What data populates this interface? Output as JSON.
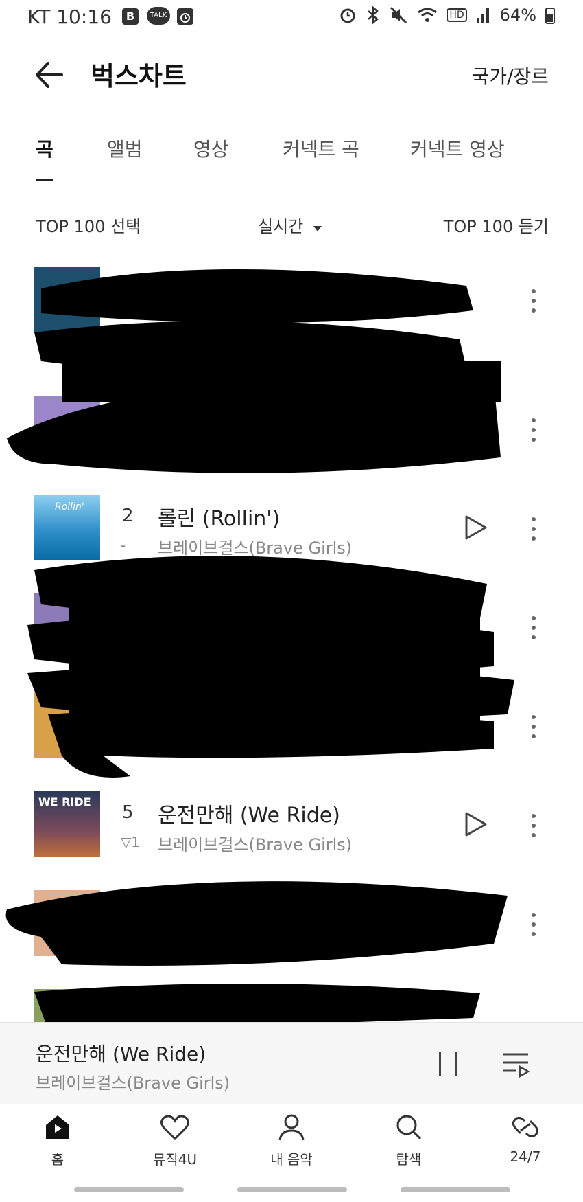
{
  "status_bar": {
    "carrier_time": "KT 10:16",
    "icons": [
      "b-icon",
      "talk-icon",
      "clock-icon",
      "alarm-icon",
      "bluetooth-icon",
      "mute-icon",
      "wifi-icon",
      "hd-icon",
      "signal-icon"
    ],
    "talk_label": "TALK",
    "b_label": "B",
    "hd_label": "HD",
    "battery": "64%"
  },
  "header": {
    "title": "벅스차트",
    "country_genre": "국가/장르"
  },
  "tabs": [
    {
      "label": "곡",
      "active": true
    },
    {
      "label": "앨범"
    },
    {
      "label": "영상"
    },
    {
      "label": "커넥트 곡"
    },
    {
      "label": "커넥트 영상"
    }
  ],
  "controls": {
    "top100_select": "TOP 100 선택",
    "realtime": "실시간",
    "top100_listen": "TOP 100 듣기"
  },
  "songs": [
    {
      "rank": "2",
      "change": "-",
      "title": "롤린 (Rollin')",
      "artist": "브레이브걸스(Brave Girls)",
      "cover_text": "Rollin'"
    },
    {
      "rank": "5",
      "change": "▽1",
      "title": "운전만해 (We Ride)",
      "artist": "브레이브걸스(Brave Girls)",
      "cover_text": "WE RIDE"
    }
  ],
  "mini_player": {
    "title": "운전만해 (We Ride)",
    "artist": "브레이브걸스(Brave Girls)"
  },
  "nav": [
    {
      "label": "홈",
      "icon": "home-icon"
    },
    {
      "label": "뮤직4U",
      "icon": "heart-icon"
    },
    {
      "label": "내 음악",
      "icon": "person-icon"
    },
    {
      "label": "탐색",
      "icon": "search-icon"
    },
    {
      "label": "24/7",
      "icon": "link-icon"
    }
  ],
  "colors": {
    "accent": "#222222",
    "muted": "#888888",
    "redaction": "#000000"
  }
}
